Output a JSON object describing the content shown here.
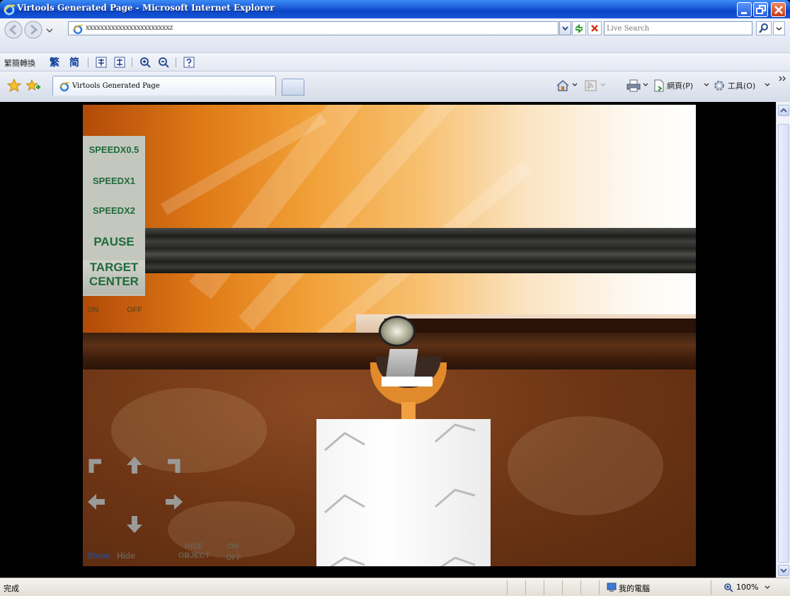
{
  "window": {
    "title": "Virtools Generated Page - Microsoft Internet Explorer"
  },
  "address_bar": {
    "url": "xxxxxxxxxxxxxxxxxxxxxxxz",
    "search_placeholder": "Live Search"
  },
  "lang_toolbar": {
    "label": "繁簡轉換",
    "trad_label": "繁",
    "simp_label": "简"
  },
  "tabs": [
    {
      "label": "Virtools Generated Page"
    }
  ],
  "command_bar": {
    "page_label": "網頁(P)",
    "tools_label": "工具(O)"
  },
  "scene": {
    "speed_buttons": [
      "SPEEDX0.5",
      "SPEEDX1",
      "SPEEDX2"
    ],
    "pause_label": "PAUSE",
    "target_center_label": "TARGET\nCENTER",
    "on_label": "ON",
    "off_label": "OFF",
    "show_label": "Show",
    "hide_label": "Hide",
    "hide_object_label": "HIDE\nOBJECT",
    "object_on_label": "ON",
    "object_off_label": "OFF"
  },
  "status_bar": {
    "status_text": "完成",
    "zone_label": "我的電腦",
    "zoom_label": "100%"
  },
  "colors": {
    "title_bar": "#0b45c7",
    "menu_text": "#1e6b3a",
    "menu_bg": "#c4c7be"
  }
}
